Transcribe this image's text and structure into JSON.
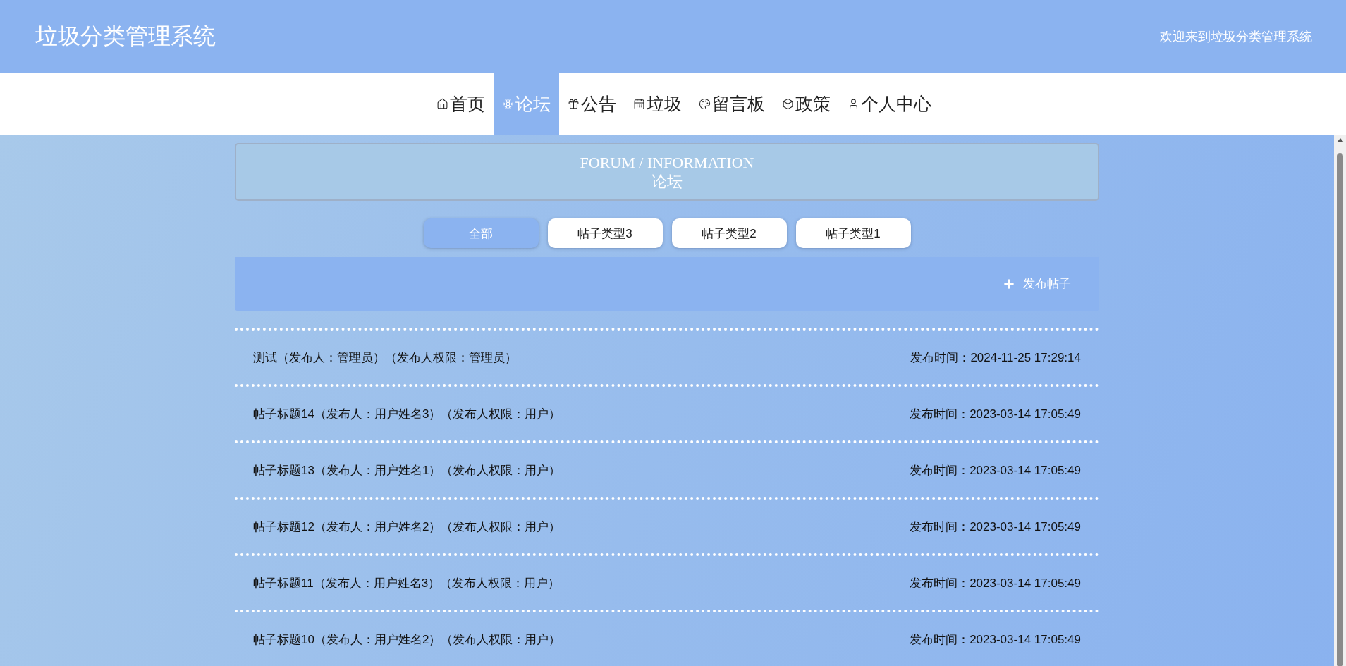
{
  "header": {
    "title": "垃圾分类管理系统",
    "welcome": "欢迎来到垃圾分类管理系统"
  },
  "nav": [
    {
      "label": "首页",
      "kind": "home",
      "selected": false
    },
    {
      "label": "论坛",
      "kind": "snow",
      "selected": true
    },
    {
      "label": "公告",
      "kind": "gift",
      "selected": false
    },
    {
      "label": "垃圾",
      "kind": "calendar",
      "selected": false
    },
    {
      "label": "留言板",
      "kind": "palette",
      "selected": false
    },
    {
      "label": "政策",
      "kind": "box",
      "selected": false
    },
    {
      "label": "个人中心",
      "kind": "user",
      "selected": false
    }
  ],
  "banner": {
    "title": "FORUM / INFORMATION",
    "subtitle": "论坛"
  },
  "filters": [
    {
      "label": "全部",
      "selected": true
    },
    {
      "label": "帖子类型3",
      "selected": false
    },
    {
      "label": "帖子类型2",
      "selected": false
    },
    {
      "label": "帖子类型1",
      "selected": false
    }
  ],
  "post_button": "发布帖子",
  "posts": [
    {
      "title": "测试（发布人：管理员）（发布人权限：管理员）",
      "time": "发布时间：2024-11-25 17:29:14"
    },
    {
      "title": "帖子标题14（发布人：用户姓名3）（发布人权限：用户）",
      "time": "发布时间：2023-03-14 17:05:49"
    },
    {
      "title": "帖子标题13（发布人：用户姓名1）（发布人权限：用户）",
      "time": "发布时间：2023-03-14 17:05:49"
    },
    {
      "title": "帖子标题12（发布人：用户姓名2）（发布人权限：用户）",
      "time": "发布时间：2023-03-14 17:05:49"
    },
    {
      "title": "帖子标题11（发布人：用户姓名3）（发布人权限：用户）",
      "time": "发布时间：2023-03-14 17:05:49"
    },
    {
      "title": "帖子标题10（发布人：用户姓名2）（发布人权限：用户）",
      "time": "发布时间：2023-03-14 17:05:49"
    }
  ]
}
